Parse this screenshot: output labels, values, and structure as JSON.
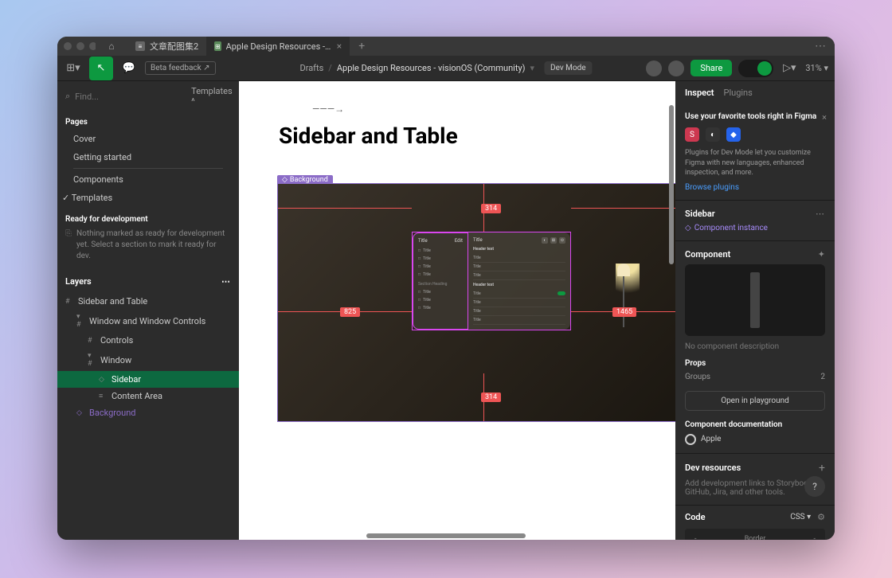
{
  "tabs": {
    "tab1": "文章配图集2",
    "tab2": "Apple Design Resources - visionOS (Co"
  },
  "toolbar": {
    "beta": "Beta feedback ↗",
    "breadcrumb_root": "Drafts",
    "breadcrumb_current": "Apple Design Resources - visionOS (Community)",
    "dev_mode": "Dev Mode",
    "share": "Share",
    "zoom": "31%"
  },
  "left": {
    "search_placeholder": "Find...",
    "templates": "Templates",
    "pages_label": "Pages",
    "pages": {
      "cover": "Cover",
      "getting_started": "Getting started",
      "components": "Components",
      "templates": "Templates"
    },
    "ready_title": "Ready for development",
    "ready_text": "Nothing marked as ready for development yet. Select a section to mark it ready for dev.",
    "layers_label": "Layers",
    "layers": {
      "sidebar_and_table": "Sidebar and Table",
      "window_controls": "Window and Window Controls",
      "controls": "Controls",
      "window": "Window",
      "sidebar": "Sidebar",
      "content_area": "Content Area",
      "background": "Background"
    }
  },
  "canvas": {
    "title": "Sidebar and Table",
    "bg_label": "Background",
    "dim_top": "314",
    "dim_left": "825",
    "dim_right": "1465",
    "dim_bottom": "314",
    "mini": {
      "sidebar_title": "Title",
      "edit": "Edit",
      "item": "Title",
      "section_heading": "Section Heading",
      "content_title": "Title",
      "header": "Header text",
      "row": "Title"
    }
  },
  "right": {
    "tab_inspect": "Inspect",
    "tab_plugins": "Plugins",
    "promo_title": "Use your favorite tools right in Figma",
    "promo_text": "Plugins for Dev Mode let you customize Figma with new languages, enhanced inspection, and more.",
    "promo_link": "Browse plugins",
    "selection_title": "Sidebar",
    "comp_instance": "Component instance",
    "component_label": "Component",
    "no_desc": "No component description",
    "props_label": "Props",
    "groups_label": "Groups",
    "groups_value": "2",
    "playground": "Open in playground",
    "doc_label": "Component documentation",
    "doc_apple": "Apple",
    "dev_res_label": "Dev resources",
    "dev_res_text": "Add development links to Storybook, GitHub, Jira, and other tools.",
    "code_label": "Code",
    "code_lang": "CSS",
    "border_label": "Border"
  }
}
